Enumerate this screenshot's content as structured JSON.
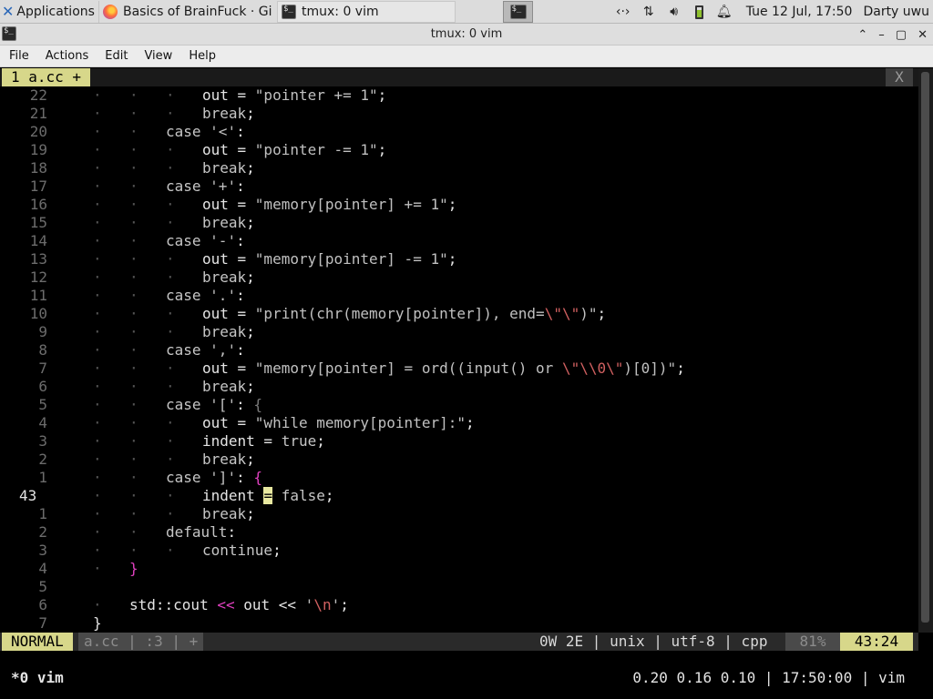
{
  "panel": {
    "applications_label": "Applications",
    "tasks": [
      {
        "title": "Basics of BrainFuck · Gi"
      },
      {
        "title": "tmux: 0 vim"
      }
    ],
    "clock": "Tue 12 Jul, 17:50",
    "user": "Darty uwu"
  },
  "window": {
    "title": "tmux: 0 vim",
    "menu": [
      "File",
      "Actions",
      "Edit",
      "View",
      "Help"
    ]
  },
  "vim": {
    "tab_label": "1 a.cc +",
    "tab_close": "X",
    "lines": [
      {
        "num": "22",
        "indent": 3,
        "segments": [
          {
            "c": "s",
            "t": "out = "
          },
          {
            "c": "st",
            "t": "\"pointer += 1\""
          },
          {
            "c": "s",
            "t": ";"
          }
        ]
      },
      {
        "num": "21",
        "indent": 3,
        "segments": [
          {
            "c": "kw",
            "t": "break"
          },
          {
            "c": "s",
            "t": ";"
          }
        ]
      },
      {
        "num": "20",
        "indent": 2,
        "segments": [
          {
            "c": "kw",
            "t": "case "
          },
          {
            "c": "st",
            "t": "'<'"
          },
          {
            "c": "s",
            "t": ":"
          }
        ]
      },
      {
        "num": "19",
        "indent": 3,
        "segments": [
          {
            "c": "s",
            "t": "out = "
          },
          {
            "c": "st",
            "t": "\"pointer -= 1\""
          },
          {
            "c": "s",
            "t": ";"
          }
        ]
      },
      {
        "num": "18",
        "indent": 3,
        "segments": [
          {
            "c": "kw",
            "t": "break"
          },
          {
            "c": "s",
            "t": ";"
          }
        ]
      },
      {
        "num": "17",
        "indent": 2,
        "segments": [
          {
            "c": "kw",
            "t": "case "
          },
          {
            "c": "st",
            "t": "'+'"
          },
          {
            "c": "s",
            "t": ":"
          }
        ]
      },
      {
        "num": "16",
        "indent": 3,
        "segments": [
          {
            "c": "s",
            "t": "out = "
          },
          {
            "c": "st",
            "t": "\"memory[pointer] += 1\""
          },
          {
            "c": "s",
            "t": ";"
          }
        ]
      },
      {
        "num": "15",
        "indent": 3,
        "segments": [
          {
            "c": "kw",
            "t": "break"
          },
          {
            "c": "s",
            "t": ";"
          }
        ]
      },
      {
        "num": "14",
        "indent": 2,
        "segments": [
          {
            "c": "kw",
            "t": "case "
          },
          {
            "c": "st",
            "t": "'-'"
          },
          {
            "c": "s",
            "t": ":"
          }
        ]
      },
      {
        "num": "13",
        "indent": 3,
        "segments": [
          {
            "c": "s",
            "t": "out = "
          },
          {
            "c": "st",
            "t": "\"memory[pointer] -= 1\""
          },
          {
            "c": "s",
            "t": ";"
          }
        ]
      },
      {
        "num": "12",
        "indent": 3,
        "segments": [
          {
            "c": "kw",
            "t": "break"
          },
          {
            "c": "s",
            "t": ";"
          }
        ]
      },
      {
        "num": "11",
        "indent": 2,
        "segments": [
          {
            "c": "kw",
            "t": "case "
          },
          {
            "c": "st",
            "t": "'.'"
          },
          {
            "c": "s",
            "t": ":"
          }
        ]
      },
      {
        "num": "10",
        "indent": 3,
        "segments": [
          {
            "c": "s",
            "t": "out = "
          },
          {
            "c": "st",
            "t": "\"print(chr(memory[pointer]), end="
          },
          {
            "c": "esc",
            "t": "\\\"\\\""
          },
          {
            "c": "st",
            "t": ")\""
          },
          {
            "c": "s",
            "t": ";"
          }
        ]
      },
      {
        "num": "9",
        "indent": 3,
        "segments": [
          {
            "c": "kw",
            "t": "break"
          },
          {
            "c": "s",
            "t": ";"
          }
        ]
      },
      {
        "num": "8",
        "indent": 2,
        "segments": [
          {
            "c": "kw",
            "t": "case "
          },
          {
            "c": "st",
            "t": "','"
          },
          {
            "c": "s",
            "t": ":"
          }
        ]
      },
      {
        "num": "7",
        "indent": 3,
        "segments": [
          {
            "c": "s",
            "t": "out = "
          },
          {
            "c": "st",
            "t": "\"memory[pointer] = ord((input() or "
          },
          {
            "c": "esc",
            "t": "\\\"\\\\0\\\""
          },
          {
            "c": "st",
            "t": ")[0])\""
          },
          {
            "c": "s",
            "t": ";"
          }
        ]
      },
      {
        "num": "6",
        "indent": 3,
        "segments": [
          {
            "c": "kw",
            "t": "break"
          },
          {
            "c": "s",
            "t": ";"
          }
        ]
      },
      {
        "num": "5",
        "indent": 2,
        "segments": [
          {
            "c": "kw",
            "t": "case "
          },
          {
            "c": "st",
            "t": "'['"
          },
          {
            "c": "s",
            "t": ": "
          },
          {
            "c": "dim",
            "t": "{"
          }
        ]
      },
      {
        "num": "4",
        "indent": 3,
        "segments": [
          {
            "c": "s",
            "t": "out = "
          },
          {
            "c": "st",
            "t": "\"while memory[pointer]:\""
          },
          {
            "c": "s",
            "t": ";"
          }
        ]
      },
      {
        "num": "3",
        "indent": 3,
        "segments": [
          {
            "c": "s",
            "t": "indent = "
          },
          {
            "c": "kw",
            "t": "true"
          },
          {
            "c": "s",
            "t": ";"
          }
        ]
      },
      {
        "num": "2",
        "indent": 3,
        "segments": [
          {
            "c": "kw",
            "t": "break"
          },
          {
            "c": "s",
            "t": ";"
          }
        ]
      },
      {
        "num": "1",
        "indent": 2,
        "segments": [
          {
            "c": "kw",
            "t": "case "
          },
          {
            "c": "st",
            "t": "']'"
          },
          {
            "c": "s",
            "t": ": "
          },
          {
            "c": "br",
            "t": "{"
          }
        ]
      },
      {
        "num": "43",
        "current": true,
        "indent": 3,
        "segments": [
          {
            "c": "s",
            "t": "indent "
          },
          {
            "c": "cursor",
            "t": "="
          },
          {
            "c": "s",
            "t": " "
          },
          {
            "c": "kw",
            "t": "false"
          },
          {
            "c": "s",
            "t": ";"
          }
        ]
      },
      {
        "num": "1",
        "indent": 3,
        "segments": [
          {
            "c": "kw",
            "t": "break"
          },
          {
            "c": "s",
            "t": ";"
          }
        ]
      },
      {
        "num": "2",
        "indent": 2,
        "segments": [
          {
            "c": "kw",
            "t": "default"
          },
          {
            "c": "s",
            "t": ":"
          }
        ]
      },
      {
        "num": "3",
        "indent": 3,
        "segments": [
          {
            "c": "kw",
            "t": "continue"
          },
          {
            "c": "s",
            "t": ";"
          }
        ]
      },
      {
        "num": "4",
        "indent": 1,
        "segments": [
          {
            "c": "br",
            "t": "}"
          }
        ]
      },
      {
        "num": "5",
        "indent": 0,
        "segments": []
      },
      {
        "num": "6",
        "indent": 1,
        "segments": [
          {
            "c": "s",
            "t": "std::cout "
          },
          {
            "c": "br",
            "t": "<<"
          },
          {
            "c": "s",
            "t": " out "
          },
          {
            "c": "s",
            "t": "<<"
          },
          {
            "c": "s",
            "t": " "
          },
          {
            "c": "st",
            "t": "'"
          },
          {
            "c": "esc",
            "t": "\\n"
          },
          {
            "c": "st",
            "t": "'"
          },
          {
            "c": "s",
            "t": ";"
          }
        ]
      },
      {
        "num": "7",
        "indent": 0,
        "segments": [
          {
            "c": "s",
            "t": "}"
          }
        ]
      }
    ],
    "status": {
      "mode": "NORMAL",
      "file": "a.cc | :3 | +",
      "info": "0W 2E | unix | utf-8 | cpp",
      "percent": "81%",
      "position": "43:24"
    }
  },
  "tmux": {
    "window_label": "*0 vim",
    "status_right": "0.20 0.16 0.10 | 17:50:00 | vim"
  },
  "colors": {
    "statusline_accent": "#d7d78a",
    "terminal_bg": "#000000",
    "bracket": "#e040c0",
    "escape": "#d06060"
  }
}
